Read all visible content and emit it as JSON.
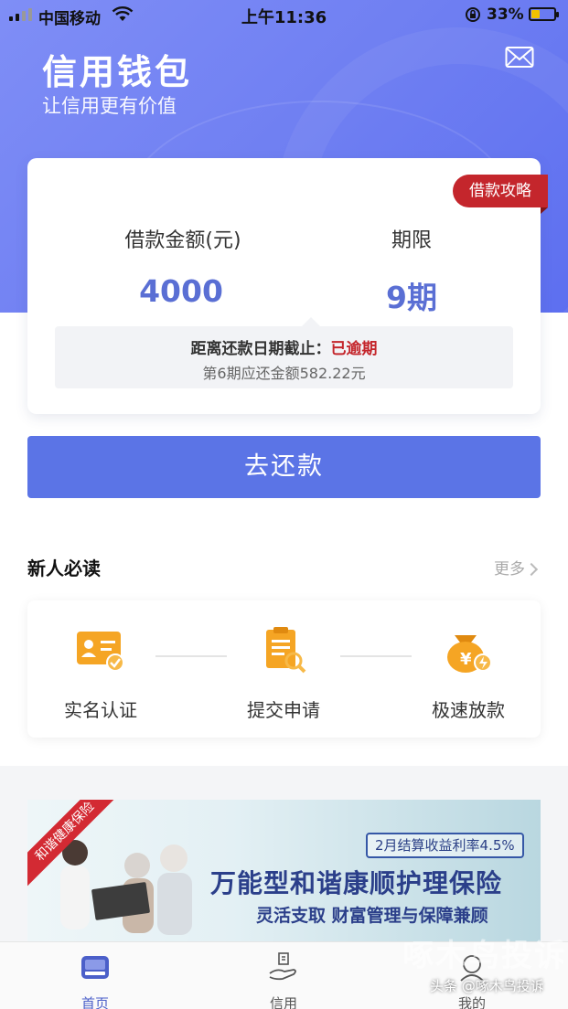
{
  "status_bar": {
    "carrier": "中国移动",
    "time": "上午11:36",
    "battery_percent": "33%",
    "battery_level": 0.33,
    "icons": [
      "signal-icon",
      "wifi-icon",
      "orientation-lock-icon",
      "battery-icon"
    ]
  },
  "header": {
    "title": "信用钱包",
    "subtitle": "让信用更有价值",
    "icons": [
      "mail-icon"
    ]
  },
  "loan_card": {
    "badge": "借款攻略",
    "amount_label": "借款金额(元)",
    "amount_value": "4000",
    "term_label": "期限",
    "term_value": "9期",
    "due_prefix": "距离还款日期截止：",
    "due_status": "已逾期",
    "due_amount": "第6期应还金额582.22元",
    "accent_color": "#5a6fd4",
    "alert_color": "#c4262c"
  },
  "repay_button": {
    "label": "去还款",
    "color": "#5b74e6"
  },
  "newcomer": {
    "title": "新人必读",
    "more": "更多",
    "steps": [
      {
        "label": "实名认证",
        "icon": "id-card-icon"
      },
      {
        "label": "提交申请",
        "icon": "clipboard-icon"
      },
      {
        "label": "极速放款",
        "icon": "money-bag-icon"
      }
    ]
  },
  "banner": {
    "ribbon": "和谐健康保险",
    "rate_tag": "2月结算收益利率4.5%",
    "title": "万能型和谐康顺护理保险",
    "subtitle": "灵活支取 财富管理与保障兼顾"
  },
  "tabbar": {
    "tabs": [
      {
        "label": "首页",
        "icon": "home-icon",
        "active": true
      },
      {
        "label": "信用",
        "icon": "credit-hand-icon",
        "active": false
      },
      {
        "label": "我的",
        "icon": "profile-icon",
        "active": false
      }
    ]
  },
  "watermark": {
    "big": "啄木鸟投诉",
    "small": "头条 @啄木鸟投诉"
  }
}
